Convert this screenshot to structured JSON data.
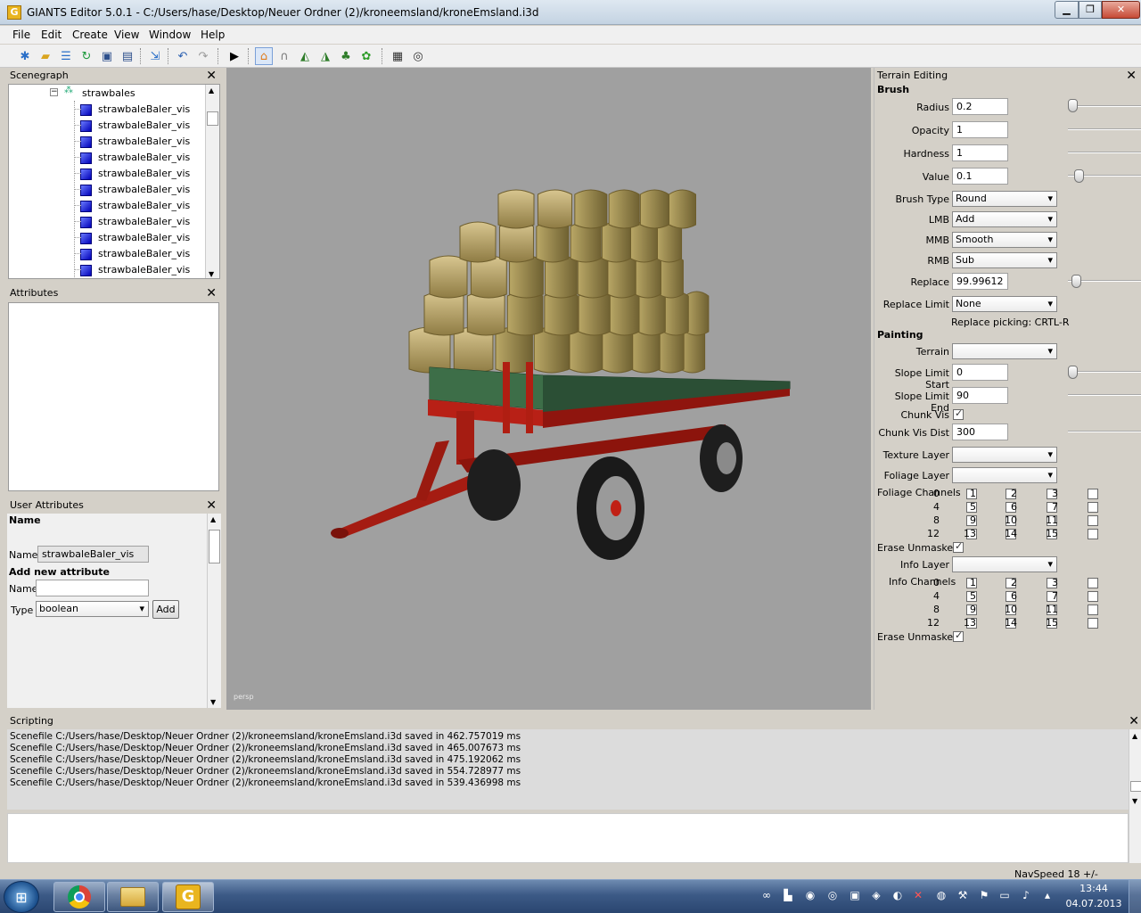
{
  "window": {
    "title": "GIANTS Editor 5.0.1 - C:/Users/hase/Desktop/Neuer Ordner (2)/kroneemsland/kroneEmsland.i3d",
    "app_icon": "giants-editor-icon"
  },
  "menu": [
    "File",
    "Edit",
    "Create",
    "View",
    "Window",
    "Help"
  ],
  "toolbar": {
    "icons": [
      "new-scene-icon",
      "open-icon",
      "properties-icon",
      "refresh-icon",
      "save-icon",
      "save-as-icon",
      "import-icon",
      "undo-icon",
      "redo-icon",
      "play-icon",
      "select-tool-icon",
      "move-tool-icon",
      "terrain-sculpt-icon",
      "terrain-paint-icon",
      "foliage-paint-icon",
      "object-paint-icon",
      "texture-paint-icon",
      "snap-icon"
    ]
  },
  "scenegraph": {
    "title": "Scenegraph",
    "parent": "strawbales",
    "items": [
      "strawbaleBaler_vis",
      "strawbaleBaler_vis",
      "strawbaleBaler_vis",
      "strawbaleBaler_vis",
      "strawbaleBaler_vis",
      "strawbaleBaler_vis",
      "strawbaleBaler_vis",
      "strawbaleBaler_vis",
      "strawbaleBaler_vis",
      "strawbaleBaler_vis",
      "strawbaleBaler_vis"
    ]
  },
  "attributes": {
    "title": "Attributes"
  },
  "user_attributes": {
    "title": "User Attributes",
    "name_header": "Name",
    "name_label": "Name",
    "name_value": "strawbaleBaler_vis",
    "add_header": "Add new attribute",
    "new_name_label": "Name",
    "new_name_value": "",
    "type_label": "Type",
    "type_value": "boolean",
    "add_button": "Add"
  },
  "viewport": {
    "camera_label": "persp"
  },
  "terrain_editing": {
    "title": "Terrain Editing",
    "brush_header": "Brush",
    "radius_label": "Radius",
    "radius": "0.2",
    "radius_level": 0.0,
    "opacity_label": "Opacity",
    "opacity": "1",
    "hardness_label": "Hardness",
    "hardness": "1",
    "value_label": "Value",
    "value": "0.1",
    "value_level": 0.1,
    "brush_type_label": "Brush Type",
    "brush_type": "Round",
    "lmb_label": "LMB",
    "lmb": "Add",
    "mmb_label": "MMB",
    "mmb": "Smooth",
    "rmb_label": "RMB",
    "rmb": "Sub",
    "replace_label": "Replace",
    "replace": "99.99612",
    "replace_level": 0.05,
    "replace_limit_label": "Replace Limit",
    "replace_limit": "None",
    "replace_hint": "Replace picking: CRTL-R",
    "painting_header": "Painting",
    "terrain_label": "Terrain",
    "terrain": "",
    "slope_start_label": "Slope Limit Start",
    "slope_start": "0",
    "slope_start_level": 0.0,
    "slope_end_label": "Slope Limit End",
    "slope_end": "90",
    "chunk_vis_label": "Chunk Vis",
    "chunk_vis": true,
    "chunk_vis_dist_label": "Chunk Vis Dist",
    "chunk_vis_dist": "300",
    "texture_layer_label": "Texture Layer",
    "texture_layer": "",
    "foliage_layer_label": "Foliage Layer",
    "foliage_layer": "",
    "foliage_channels_label": "Foliage Channels",
    "erase_unmasked_label": "Erase Unmasked",
    "erase_unmasked_1": true,
    "info_layer_label": "Info Layer",
    "info_layer": "",
    "info_channels_label": "Info Channels",
    "erase_unmasked_2": true,
    "channels": [
      "0",
      "1",
      "2",
      "3",
      "4",
      "5",
      "6",
      "7",
      "8",
      "9",
      "10",
      "11",
      "12",
      "13",
      "14",
      "15"
    ]
  },
  "scripting": {
    "title": "Scripting",
    "log": [
      "Scenefile C:/Users/hase/Desktop/Neuer Ordner (2)/kroneemsland/kroneEmsland.i3d saved in 462.757019 ms",
      "Scenefile C:/Users/hase/Desktop/Neuer Ordner (2)/kroneemsland/kroneEmsland.i3d saved in 465.007673 ms",
      "Scenefile C:/Users/hase/Desktop/Neuer Ordner (2)/kroneemsland/kroneEmsland.i3d saved in 475.192062 ms",
      "Scenefile C:/Users/hase/Desktop/Neuer Ordner (2)/kroneemsland/kroneEmsland.i3d saved in 554.728977 ms",
      "Scenefile C:/Users/hase/Desktop/Neuer Ordner (2)/kroneemsland/kroneEmsland.i3d saved in 539.436998 ms"
    ]
  },
  "statusbar": {
    "navspeed": "NavSpeed 18 +/-"
  },
  "taskbar": {
    "apps": [
      "chrome-icon",
      "explorer-icon",
      "giants-editor-icon"
    ],
    "time": "13:44",
    "date": "04.07.2013"
  }
}
